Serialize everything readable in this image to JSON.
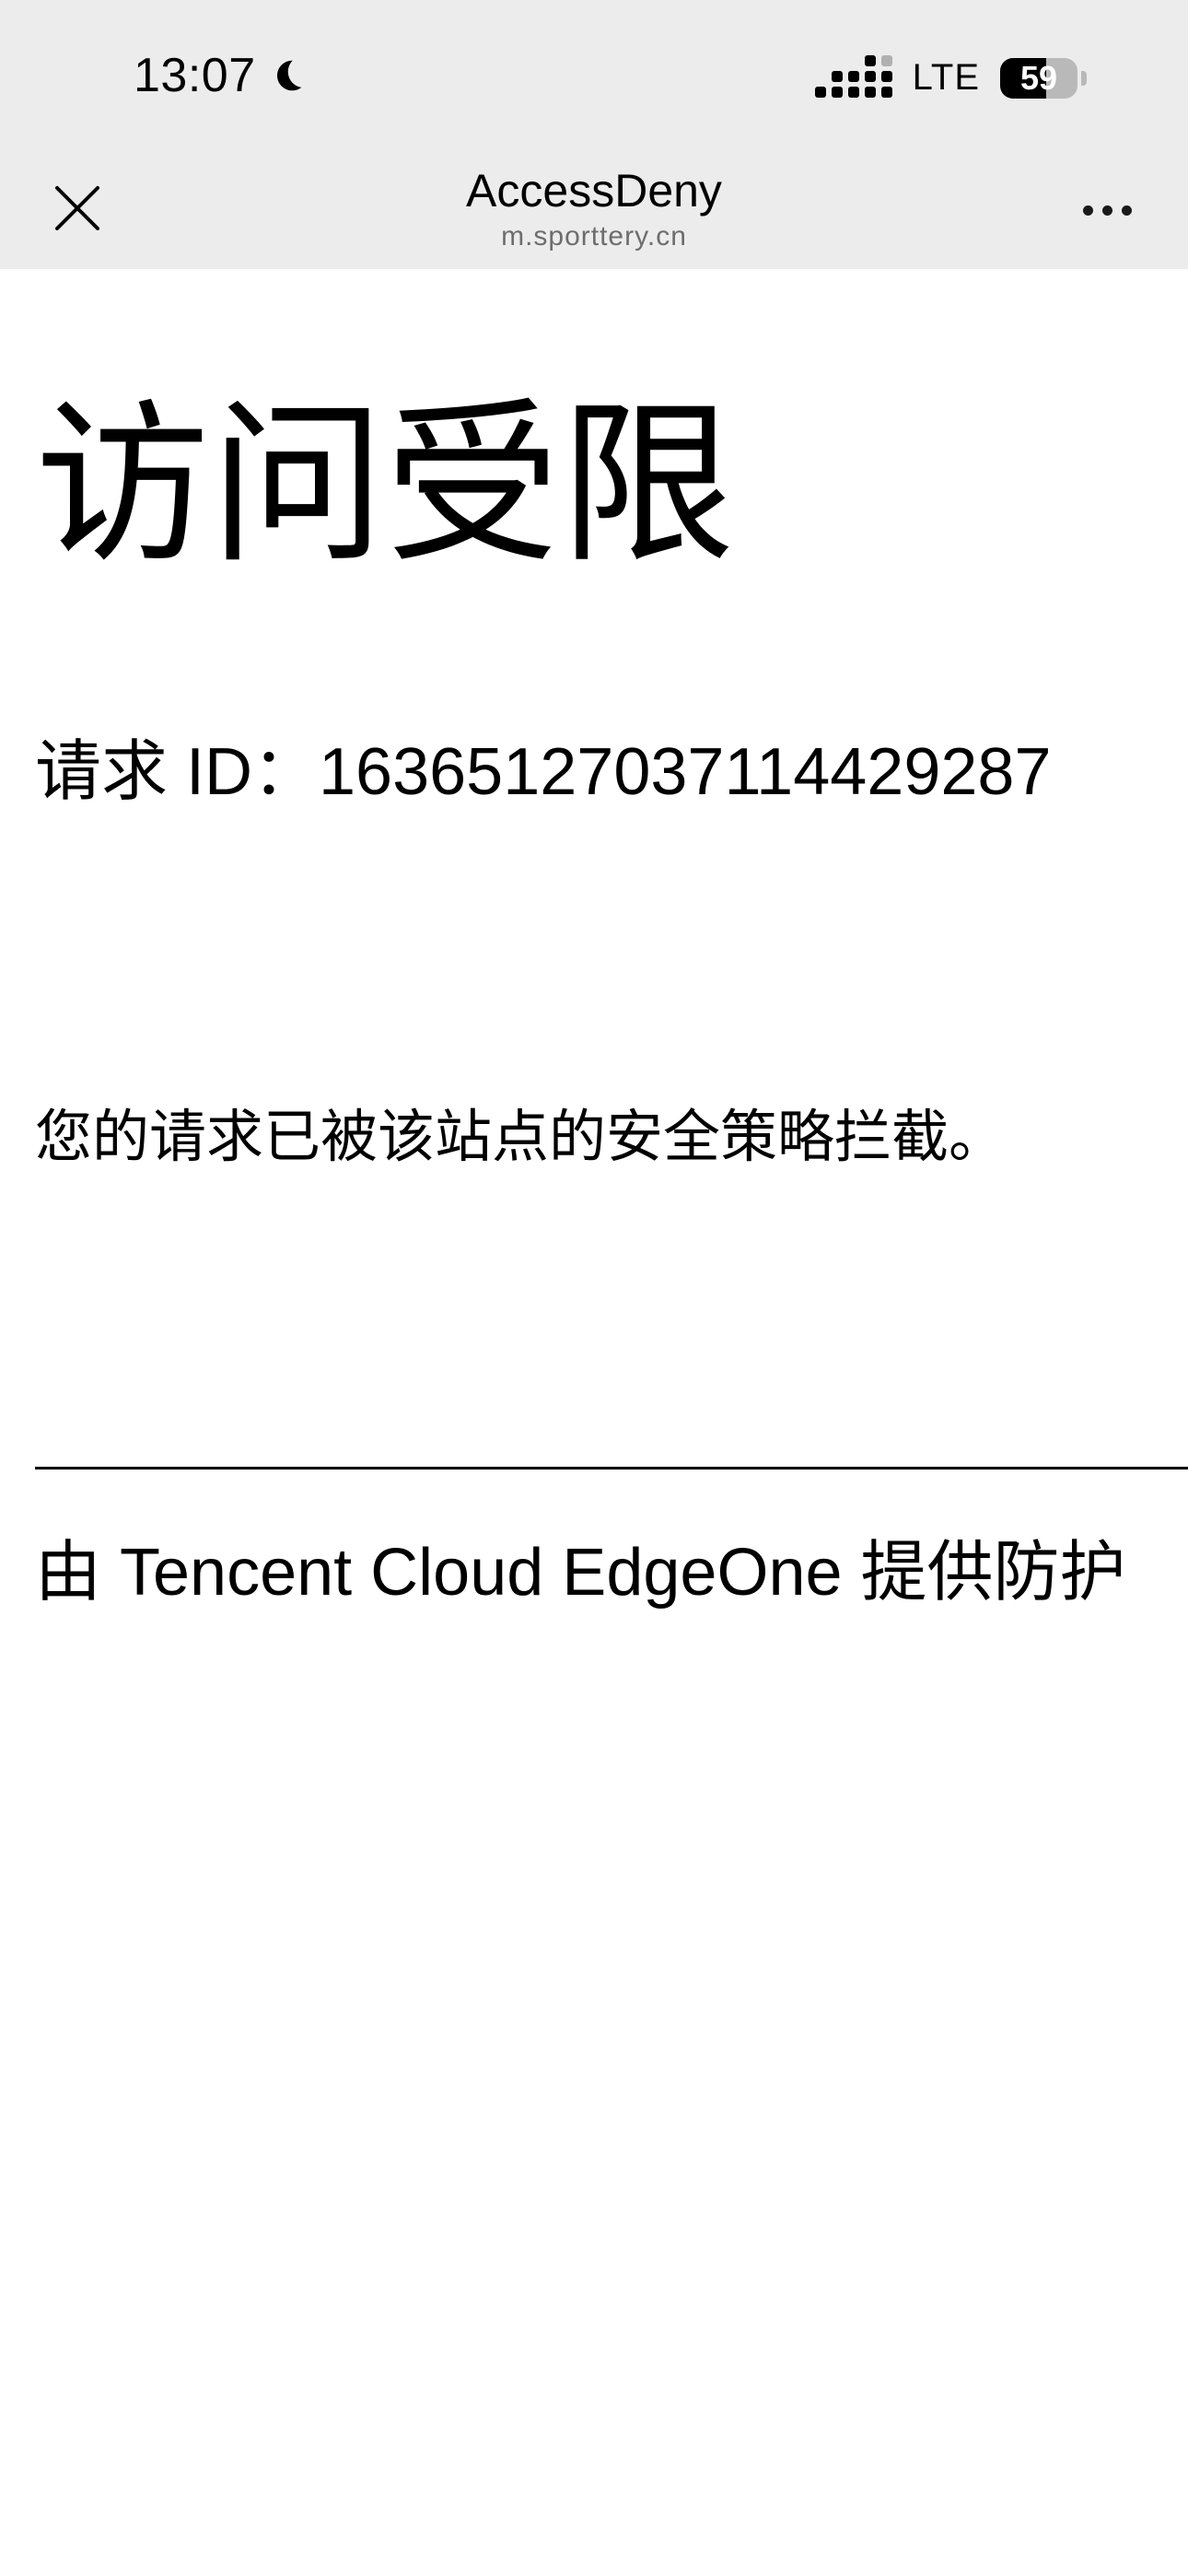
{
  "status_bar": {
    "time": "13:07",
    "network": "LTE",
    "battery": "59",
    "battery_level_percent": 59
  },
  "nav": {
    "title": "AccessDeny",
    "subtitle": "m.sporttery.cn"
  },
  "page": {
    "heading": "访问受限",
    "request_id": "请求 ID：1636512703711442928​7",
    "message": "您的请求已被该站点的安全策略拦截。",
    "footer": "由 Tencent Cloud EdgeOne 提供防护"
  },
  "icons": {
    "moon": "moon-icon",
    "signal": "cellular-signal-icon",
    "battery": "battery-icon",
    "close": "close-icon",
    "more": "more-horizontal-icon"
  }
}
